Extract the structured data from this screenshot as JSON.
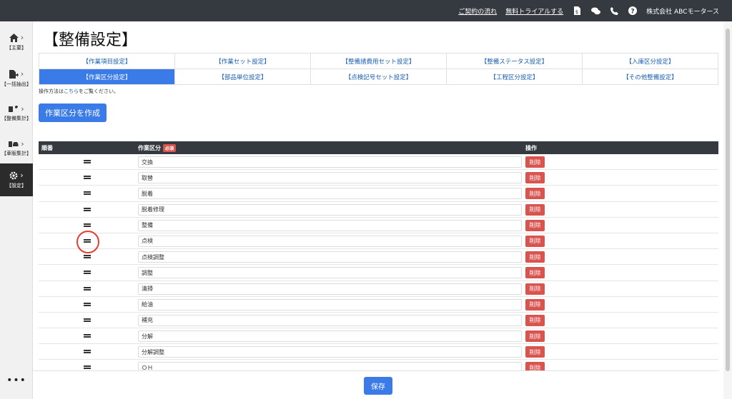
{
  "topbar": {
    "links": [
      "ご契約の流れ",
      "無料トライアルする"
    ],
    "icons": [
      "document-icon",
      "chat-icon",
      "phone-icon",
      "help-icon"
    ],
    "company": "株式会社 ABCモータース"
  },
  "sidebar": {
    "items": [
      {
        "label": "【主要】",
        "icon": "home-icon"
      },
      {
        "label": "【一括抽出】",
        "icon": "file-export-icon"
      },
      {
        "label": "【整備集計】",
        "icon": "wrench-icon"
      },
      {
        "label": "【車販集計】",
        "icon": "car-icon"
      },
      {
        "label": "【設定】",
        "icon": "gear-icon"
      }
    ],
    "more": "•••"
  },
  "page_title": "【整備設定】",
  "tabs": [
    "【作業項目設定】",
    "【作業セット設定】",
    "【整備諸費用セット設定】",
    "【整備ステータス設定】",
    "【入庫区分設定】",
    "【作業区分設定】",
    "【部品単位設定】",
    "【点検記号セット設定】",
    "【工程区分設定】",
    "【その他整備設定】"
  ],
  "active_tab": "【作業区分設定】",
  "help": {
    "prefix": "操作方法は",
    "link": "こちら",
    "suffix": "をご覧ください。"
  },
  "create_button": "作業区分を作成",
  "table": {
    "headers": {
      "order": "順番",
      "category": "作業区分",
      "required_badge": "必須",
      "action": "操作"
    },
    "delete_label": "削除",
    "rows": [
      "交換",
      "取替",
      "脱着",
      "脱着修理",
      "整備",
      "点検",
      "点検調整",
      "調整",
      "清掃",
      "給油",
      "補充",
      "分解",
      "分解調整",
      "ＯＨ"
    ]
  },
  "save_button": "保存",
  "colors": {
    "primary": "#3a7be8",
    "danger": "#d9534f",
    "dark": "#343a40",
    "highlight": "#e53d2f"
  }
}
